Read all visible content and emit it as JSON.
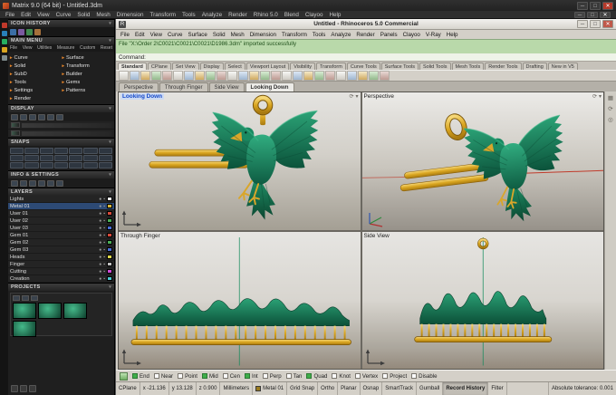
{
  "titlebar": {
    "title": "Matrix 9.0 (64 bit) - Untitled.3dm"
  },
  "matrix_menu": [
    "File",
    "Edit",
    "View",
    "Curve",
    "Solid",
    "Mesh",
    "Dimension",
    "Transform",
    "Tools",
    "Analyze",
    "Render",
    "Rhino 5.0",
    "Blend",
    "Clayoo",
    "Help"
  ],
  "matrix_panel": {
    "icon_history_label": "ICON HISTORY",
    "main_menu_label": "MAIN MENU",
    "tabs": [
      "File",
      "View",
      "Utilities",
      "Measure",
      "Custom",
      "Reset"
    ],
    "menu_items": [
      "Curve",
      "Surface",
      "Solid",
      "Transform",
      "SubD",
      "Builder",
      "Tools",
      "Gems",
      "Settings",
      "Patterns",
      "Render"
    ],
    "display_label": "DISPLAY",
    "snaps_label": "SNAPS",
    "info_label": "INFO & SETTINGS",
    "layers_label": "LAYERS",
    "projects_label": "PROJECTS",
    "layers": [
      {
        "name": "Lights",
        "color": "#f2f2f2",
        "current": false
      },
      {
        "name": "Metal 01",
        "color": "#d8b638",
        "current": true
      },
      {
        "name": "User 01",
        "color": "#d84a3a",
        "current": false
      },
      {
        "name": "User 02",
        "color": "#4aae55",
        "current": false
      },
      {
        "name": "User 03",
        "color": "#4a6ed8",
        "current": false
      },
      {
        "name": "Gem 01",
        "color": "#d84a3a",
        "current": false
      },
      {
        "name": "Gem 02",
        "color": "#4aae55",
        "current": false
      },
      {
        "name": "Gem 03",
        "color": "#4a6ed8",
        "current": false
      },
      {
        "name": "Heads",
        "color": "#e0da4a",
        "current": false
      },
      {
        "name": "Finger",
        "color": "#c0c0c0",
        "current": false
      },
      {
        "name": "Cutting",
        "color": "#cf4ad8",
        "current": false
      },
      {
        "name": "Creation",
        "color": "#4ac8cf",
        "current": false
      }
    ]
  },
  "rhino": {
    "title": "Untitled - Rhinoceros 5.0 Commercial",
    "menu": [
      "File",
      "Edit",
      "View",
      "Curve",
      "Surface",
      "Solid",
      "Mesh",
      "Dimension",
      "Transform",
      "Tools",
      "Analyze",
      "Render",
      "Panels",
      "Clayoo",
      "V-Ray",
      "Help"
    ],
    "history_line": "File \"X:\\Order 2\\C0021\\C0021\\C0021\\D1986.3dm\" imported successfully",
    "command_prompt": "Command:",
    "toolbar_tabs": [
      "Standard",
      "CPlane",
      "Set View",
      "Display",
      "Select",
      "Viewport Layout",
      "Visibility",
      "Transform",
      "Curve Tools",
      "Surface Tools",
      "Solid Tools",
      "Mesh Tools",
      "Render Tools",
      "Drafting",
      "New in V5"
    ],
    "active_toolbar_tab": "Standard",
    "viewport_tabs": [
      "Perspective",
      "Through Finger",
      "Side View",
      "Looking Down"
    ],
    "active_viewport_tab": "Looking Down",
    "viewports": {
      "top_left": "Looking Down",
      "top_right": "Perspective",
      "bottom_left": "Through Finger",
      "bottom_right": "Side View"
    },
    "osnap_items": [
      {
        "label": "End",
        "checked": true
      },
      {
        "label": "Near",
        "checked": false
      },
      {
        "label": "Point",
        "checked": false
      },
      {
        "label": "Mid",
        "checked": true
      },
      {
        "label": "Cen",
        "checked": false
      },
      {
        "label": "Int",
        "checked": true
      },
      {
        "label": "Perp",
        "checked": false
      },
      {
        "label": "Tan",
        "checked": false
      },
      {
        "label": "Quad",
        "checked": true
      },
      {
        "label": "Knot",
        "checked": false
      },
      {
        "label": "Vertex",
        "checked": false
      },
      {
        "label": "Project",
        "checked": false
      },
      {
        "label": "Disable",
        "checked": false
      }
    ],
    "status": {
      "cplane": "CPlane",
      "x": "x -21.136",
      "y": "y 13.128",
      "z": "z 0.900",
      "units": "Millimeters",
      "layer": "Metal 01",
      "layer_color": "#9a7b1e",
      "toggles": [
        "Grid Snap",
        "Ortho",
        "Planar",
        "Osnap",
        "SmartTrack",
        "Gumball",
        "Record History",
        "Filter"
      ],
      "active_toggle": "Record History",
      "tolerance": "Absolute tolerance: 0.001"
    }
  },
  "colors": {
    "eagle_green": "#1d8a63",
    "gold": "#d9a520",
    "history_green": "#b9d9aa",
    "accent_blue": "#1448c8"
  }
}
